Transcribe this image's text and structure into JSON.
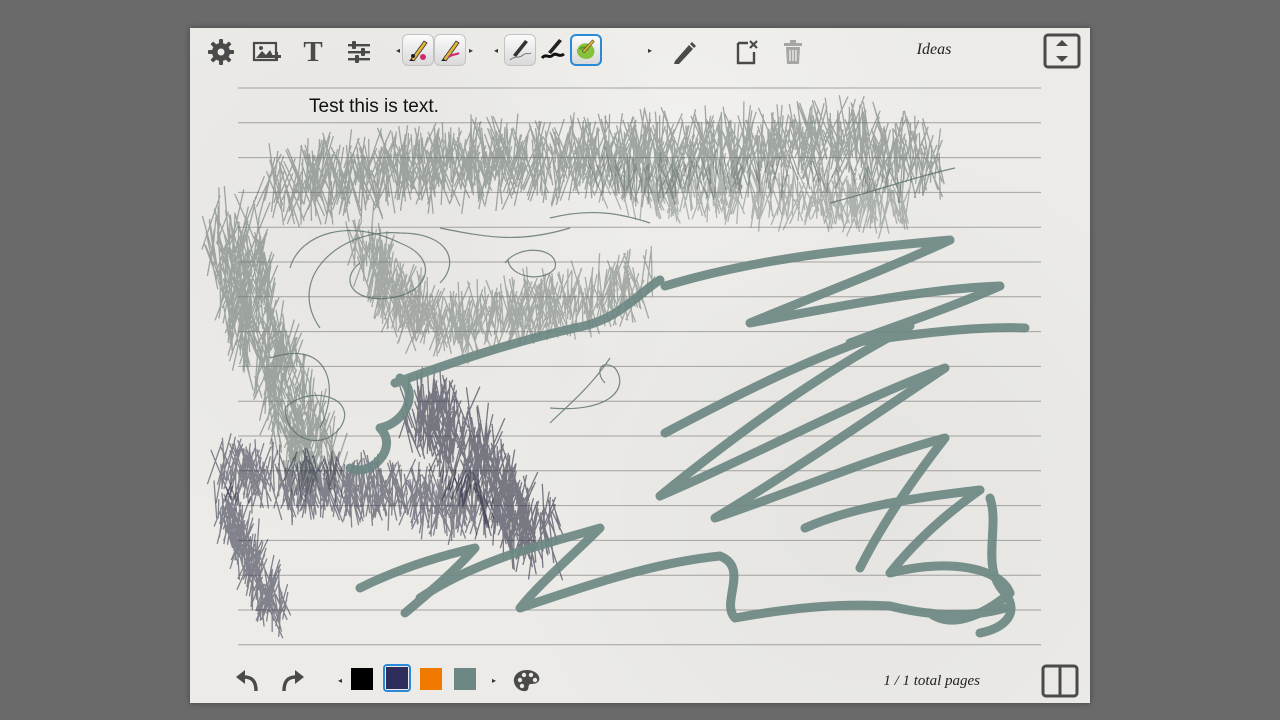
{
  "toolbar": {
    "settings_icon": "gear-icon",
    "insert_image_icon": "image-add-icon",
    "text_tool_label": "T",
    "adjust_icon": "sliders-icon",
    "eraser_icon": "pencil-icon",
    "export_icon": "export-page-icon",
    "delete_icon": "trash-icon",
    "fullscreen_icon": "fullscreen-icon",
    "notebook_title": "Ideas",
    "pen_presets": [
      {
        "name": "pen-preset-1",
        "selected": false
      },
      {
        "name": "pen-preset-2",
        "selected": false
      },
      {
        "name": "pen-preset-3",
        "selected": false
      },
      {
        "name": "pen-preset-4",
        "selected": false
      },
      {
        "name": "pen-preset-5",
        "selected": true
      }
    ]
  },
  "page": {
    "text_note": "Test this is text."
  },
  "bottom": {
    "undo_icon": "undo-icon",
    "redo_icon": "redo-icon",
    "palette_icon": "palette-icon",
    "colors": [
      "#000000",
      "#2e2c5a",
      "#f07a00",
      "#6d8884"
    ],
    "selected_color_index": 1,
    "page_indicator": "1 / 1 total pages",
    "pages_view_icon": "book-icon"
  },
  "colors": {
    "selection_accent": "#2a8ad8",
    "grass_stroke": "#5f6c66",
    "dark_stroke": "#2a2c40",
    "smooth_stroke": "#6d8884",
    "ruled_line": "#8a8a8a"
  }
}
